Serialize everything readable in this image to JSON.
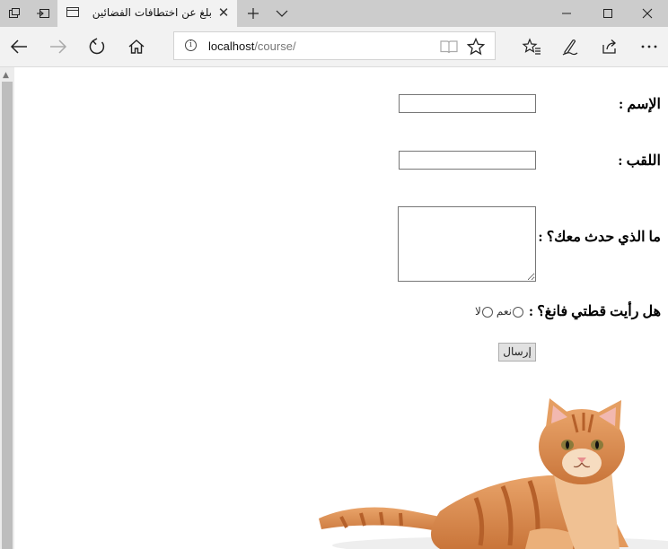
{
  "browser": {
    "tab_title": "بلغ عن اختطافات الفضائين",
    "url_host": "localhost",
    "url_path": "/course/"
  },
  "form": {
    "name_label": "الإسم :",
    "surname_label": "اللقب :",
    "story_label": "ما الذي حدث معك؟ :",
    "cat_question_label": "هل رأيت قطتي فانغ؟ :",
    "radio_yes_label": "نعم",
    "radio_no_label": "لا",
    "submit_label": "إرسال",
    "name_value": "",
    "surname_value": "",
    "story_value": ""
  },
  "image": {
    "subject": "orange tabby kitten lying down"
  }
}
